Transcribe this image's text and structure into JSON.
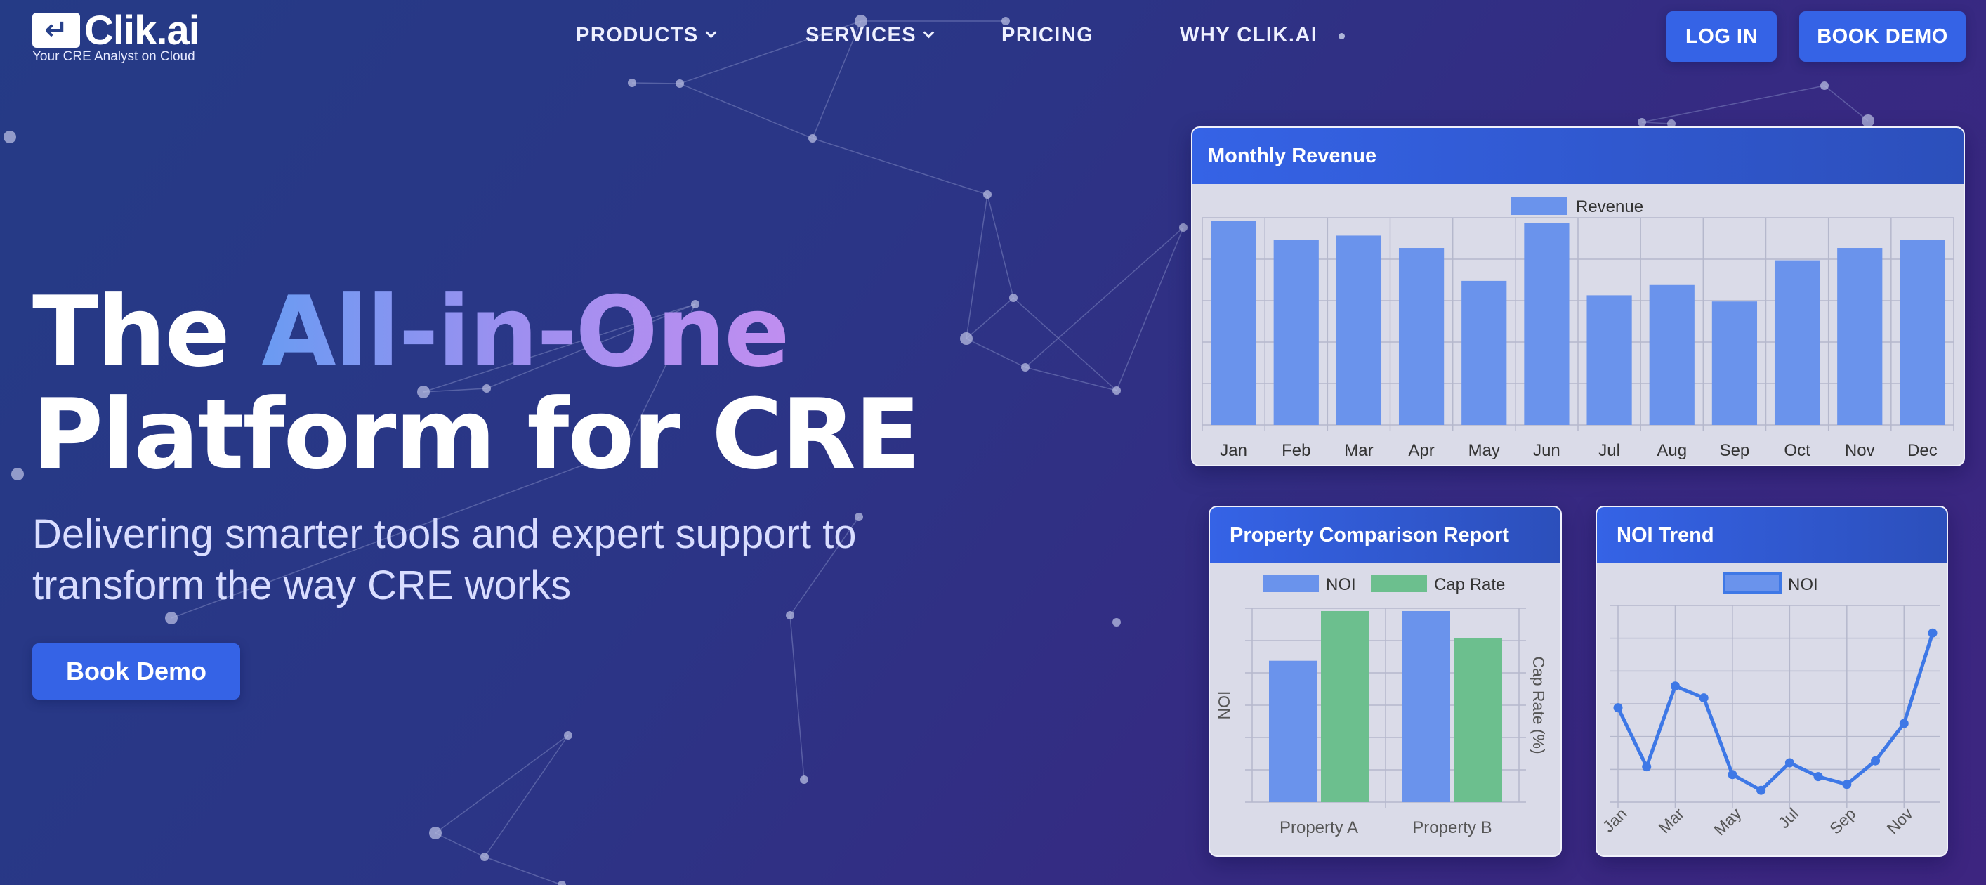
{
  "brand": {
    "logo_glyph": "↵",
    "name": "Clik.ai",
    "tagline": "Your CRE Analyst on Cloud"
  },
  "nav": {
    "items": [
      {
        "label": "PRODUCTS",
        "dropdown": true
      },
      {
        "label": "SERVICES",
        "dropdown": true
      },
      {
        "label": "PRICING",
        "dropdown": false
      },
      {
        "label": "WHY CLIK.AI",
        "dropdown": false
      }
    ],
    "login_label": "LOG IN",
    "demo_label": "BOOK DEMO"
  },
  "hero": {
    "title_prefix": "The ",
    "title_highlight": "All-in-One",
    "title_line2": "Platform for CRE",
    "subtitle": "Delivering smarter tools and expert support to transform the way CRE works",
    "cta_label": "Book Demo"
  },
  "colors": {
    "accent": "#3563e6",
    "bar_blue": "#6a93ec",
    "bar_green": "#6cbf8e",
    "line_blue": "#3e78e6"
  },
  "chart_data": [
    {
      "type": "bar",
      "title": "Monthly Revenue",
      "categories": [
        "Jan",
        "Feb",
        "Mar",
        "Apr",
        "May",
        "Jun",
        "Jul",
        "Aug",
        "Sep",
        "Oct",
        "Nov",
        "Dec"
      ],
      "series": [
        {
          "name": "Revenue",
          "values": [
            99,
            90,
            92,
            86,
            70,
            98,
            63,
            68,
            60,
            80,
            86,
            90
          ]
        }
      ],
      "ylim": [
        0,
        100
      ],
      "legend": "top-center",
      "grid": true
    },
    {
      "type": "bar",
      "title": "Property Comparison Report",
      "categories": [
        "Property A",
        "Property B"
      ],
      "series": [
        {
          "name": "NOI",
          "values": [
            74,
            100
          ]
        },
        {
          "name": "Cap Rate",
          "values": [
            100,
            86
          ]
        }
      ],
      "ylabel": "NOI",
      "y2label": "Cap Rate (%)",
      "ylim": [
        0,
        100
      ],
      "legend": "top-center",
      "grid": true
    },
    {
      "type": "line",
      "title": "NOI Trend",
      "x": [
        "Jan",
        "Feb",
        "Mar",
        "Apr",
        "May",
        "Jun",
        "Jul",
        "Aug",
        "Sep",
        "Oct",
        "Nov",
        "Dec"
      ],
      "x_tick_labels": [
        "Jan",
        "Mar",
        "May",
        "Jul",
        "Sep",
        "Nov"
      ],
      "series": [
        {
          "name": "NOI",
          "values": [
            48,
            18,
            59,
            53,
            14,
            6,
            20,
            13,
            9,
            21,
            40,
            86
          ]
        }
      ],
      "ylim": [
        0,
        100
      ],
      "legend": "top-center",
      "grid": true
    }
  ]
}
